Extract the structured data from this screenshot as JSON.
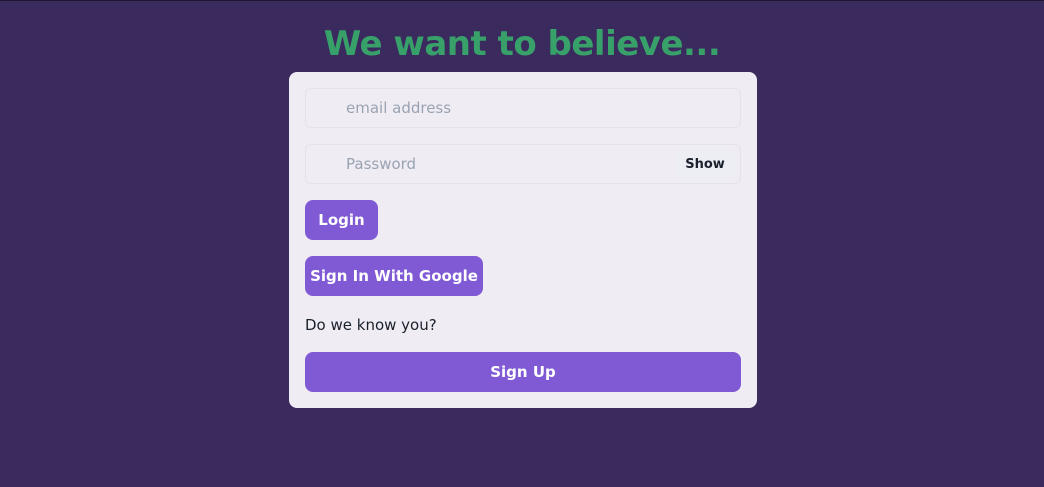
{
  "page": {
    "headline": "We want to believe..."
  },
  "form": {
    "email": {
      "placeholder": "email address",
      "value": ""
    },
    "password": {
      "placeholder": "Password",
      "value": "",
      "toggle_label": "Show"
    },
    "login_label": "Login",
    "google_label": "Sign In With Google",
    "prompt_text": "Do we know you?",
    "signup_label": "Sign Up"
  },
  "colors": {
    "background": "#3b2a5e",
    "headline": "#38a169",
    "card": "#efecf3",
    "accent_button": "#805ad5"
  }
}
